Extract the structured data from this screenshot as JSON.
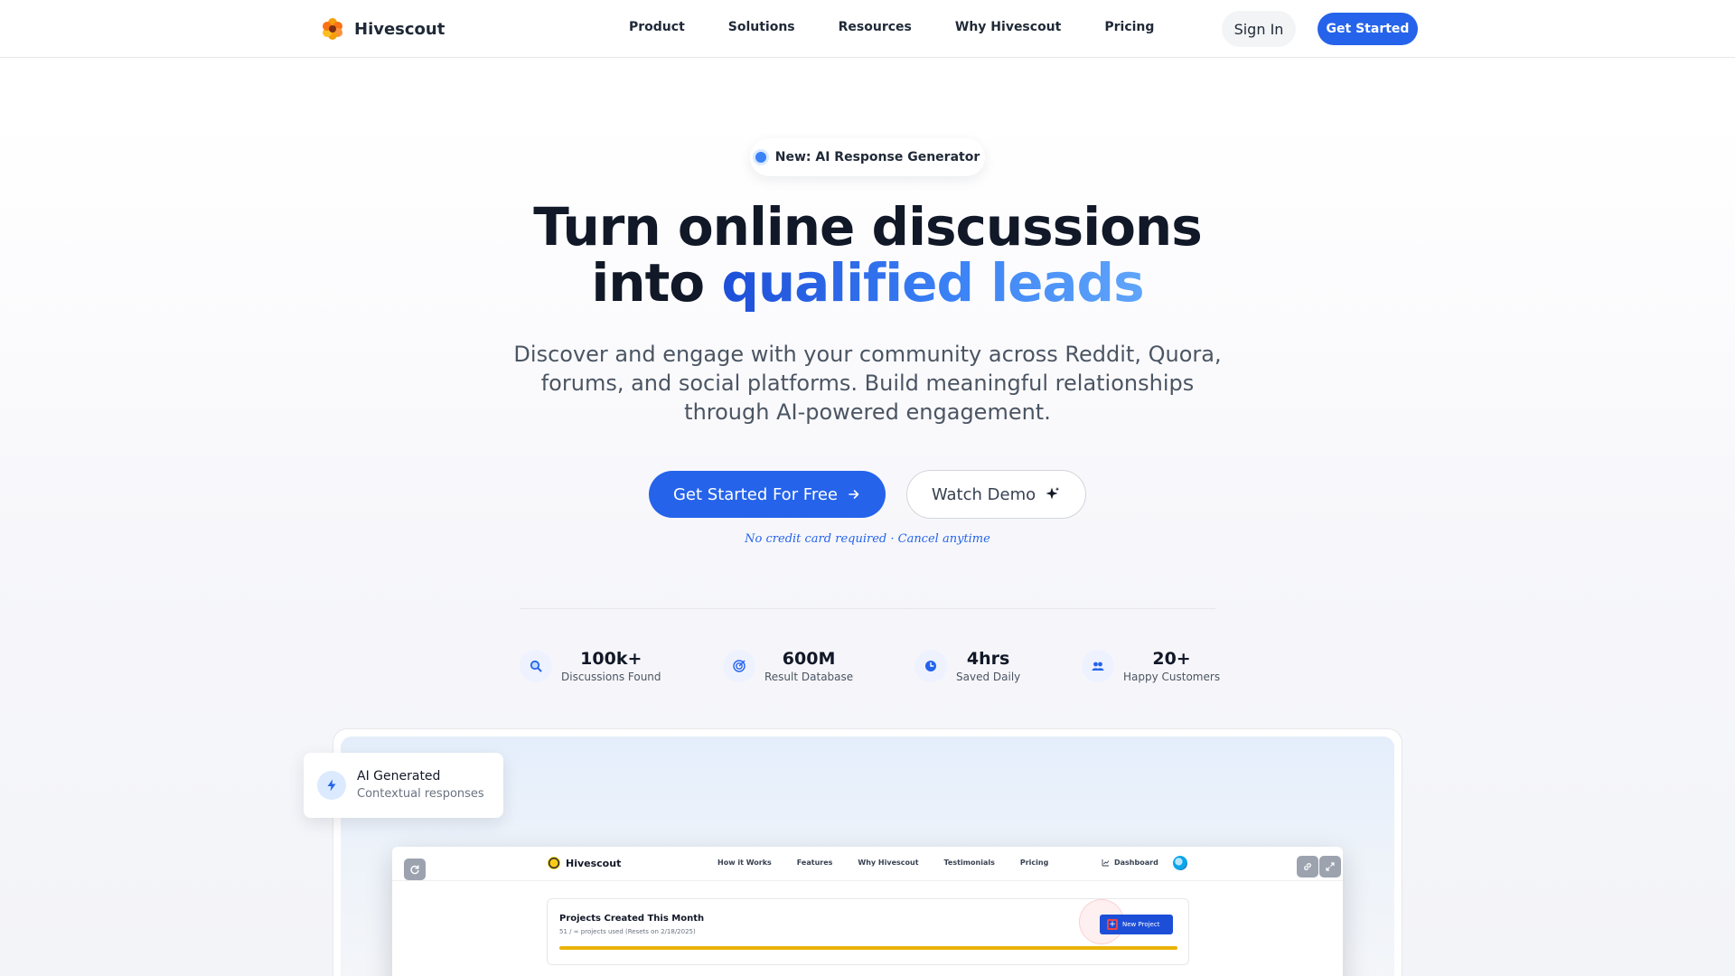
{
  "nav": {
    "brand": "Hivescout",
    "links": [
      "Product",
      "Solutions",
      "Resources",
      "Why Hivescout",
      "Pricing"
    ],
    "sign_in": "Sign In",
    "get_started": "Get Started"
  },
  "hero": {
    "badge": "New: AI Response Generator",
    "headline_line1": "Turn online discussions",
    "headline_line2_prefix": "into ",
    "headline_line2_highlight": "qualified leads",
    "subhead": "Discover and engage with your community across Reddit, Quora, forums, and social platforms. Build meaningful relationships through AI-powered engagement.",
    "cta_primary": "Get Started For Free",
    "cta_secondary": "Watch Demo",
    "note": "No credit card required · Cancel anytime"
  },
  "stats": [
    {
      "value": "100k+",
      "label": "Discussions Found",
      "icon": "search-icon"
    },
    {
      "value": "600M",
      "label": "Result Database",
      "icon": "target-icon"
    },
    {
      "value": "4hrs",
      "label": "Saved Daily",
      "icon": "clock-icon"
    },
    {
      "value": "20+",
      "label": "Happy Customers",
      "icon": "users-icon"
    }
  ],
  "float_card": {
    "title": "AI Generated",
    "subtitle": "Contextual responses",
    "icon": "lightning-icon"
  },
  "preview": {
    "brand": "Hivescout",
    "links": [
      "How it Works",
      "Features",
      "Why Hivescout",
      "Testimonials",
      "Pricing"
    ],
    "dashboard": "Dashboard",
    "card_title": "Projects Created This Month",
    "card_sub": "51 / ∞ projects used (Resets on 2/18/2025)",
    "new_project": "New Project"
  },
  "colors": {
    "accent": "#2563eb",
    "progress": "#eab308"
  }
}
